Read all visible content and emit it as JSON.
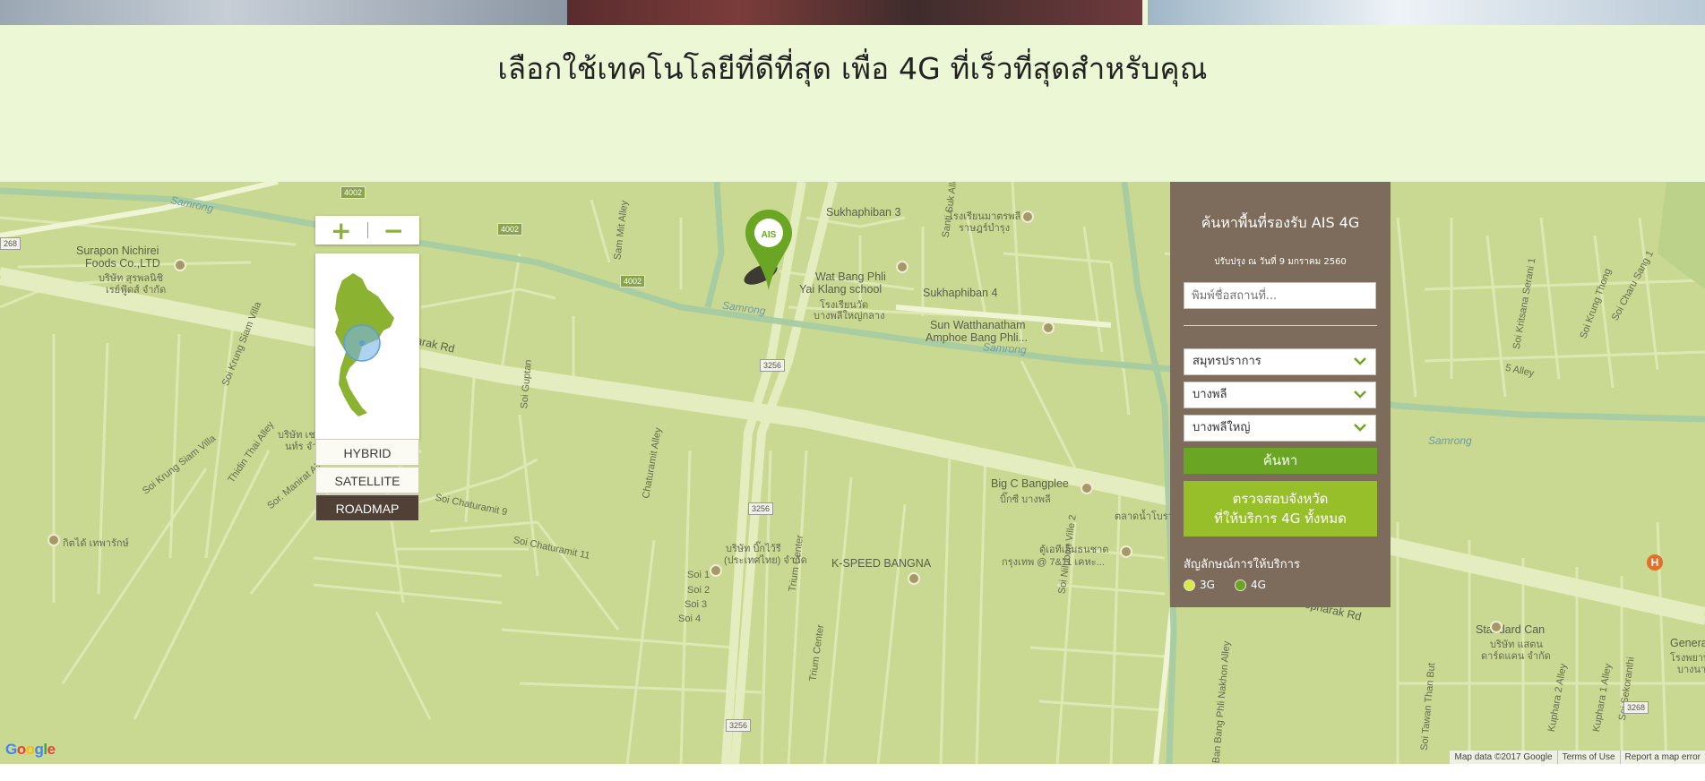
{
  "page": {
    "heading": "เลือกใช้เทคโนโลยีที่ดีที่สุด เพื่อ 4G ที่เร็วที่สุดสำหรับคุณ"
  },
  "map": {
    "zoom_in_icon": "plus-icon",
    "zoom_out_icon": "minus-icon",
    "map_types": [
      "HYBRID",
      "SATELLITE",
      "ROADMAP"
    ],
    "active_map_type": "ROADMAP",
    "marker_label": "AIS",
    "labels": {
      "surapon": "Surapon Nichirei",
      "surapon2": "Foods Co.,LTD",
      "surapon_th1": "บริษัท สุรพลนิชิ",
      "surapon_th2": "เรย์ฟู้ดส์ จำกัด",
      "sukhaphiban3": "Sukhaphiban 3",
      "sukhaphiban4": "Sukhaphiban 4",
      "watbangphli1": "Wat Bang Phli",
      "watbangphli2": "Yai Klang school",
      "watbangphli_th1": "โรงเรียนวัด",
      "watbangphli_th2": "บางพลีใหญ่กลาง",
      "sunwat1": "Sun Watthanatham",
      "sunwat2": "Amphoe Bang Phli...",
      "bigc1": "Big C Bangplee",
      "bigc_th": "บิ๊กซี บางพลี",
      "kspeed": "K-SPEED BANGNA",
      "standardcan1": "Standard Can",
      "standardcan_th1": "บริษัท แสตน",
      "standardcan_th2": "ดาร์ดแคน จำกัด",
      "thepharak": "Thepharak Rd",
      "thepharak2": "Thepharak Rd",
      "samrong1": "Samrong",
      "samrong2": "Samrong",
      "samrong3": "Samrong",
      "samrong4": "Samrong",
      "sammit": "Sam Mit Alley",
      "chaturamit9": "Soi Chaturamit 9",
      "chaturamit11": "Soi Chaturamit 11",
      "chaturamit_alley": "Chaturamit Alley",
      "soi1": "Soi 1",
      "soi2": "Soi 2",
      "soi3": "Soi 3",
      "soi4": "Soi 4",
      "trium": "Trium Center",
      "trium2": "Trium Center",
      "kingsiam": "Soi Krung Siam Villa",
      "kingsiam2": "Soi Krung Siam Villa",
      "thidin": "Thidin Thai Alley",
      "manirat": "Sor. Manirat Alley",
      "kuphara2": "Kuphara 2 Alley",
      "kuphara1": "Kuphara 1 Alley",
      "tawanthan": "Soi Tawan Than But",
      "krungthong": "Soi Krung Thong",
      "sekoranthi": "Soi Sekoranthi",
      "charu": "Soi Charu Sang 1",
      "kritsana": "Soi Kritsana Serani 1",
      "alley5": "5 Alley",
      "nilubon": "Soi Nilubon Ville 2",
      "bangphli_nakhon": "Ban Bang Phli Nakhon Alley",
      "santisuk": "Santi Suk Alley",
      "guptan": "Soi Guptan",
      "general": "Genera",
      "general_th1": "โรงพยาบา",
      "general_th2": "บางนา",
      "kittatep": "กิตได้ เทพารักษ์",
      "ams": "ตู้เอทีเอ็มธนชาต",
      "ams2": "กรุงเทพ @ 7&11 เคหะ...",
      "market": "ตลาดน้ำโบราณ",
      "bigc2": "บริษัท บิ๊กไว้รี",
      "bigc3": "(ประเทศไทย) จำกัด",
      "hospital_school": "โรงเรียนมาตรพลี",
      "hospital_school2": "ราษฎร์บำรุง",
      "nart": "นท์ร จำกัด",
      "nart2": "บริษัท เชา",
      "arak": "arak Rd",
      "shield_4002a": "4002",
      "shield_4002b": "4002",
      "shield_4002c": "4002",
      "shield_3256a": "3256",
      "shield_3256b": "3256",
      "shield_3256c": "3256",
      "shield_3268a": "3268",
      "shield_268": "268"
    },
    "attribution": [
      "Map data ©2017 Google",
      "Terms of Use",
      "Report a map error"
    ],
    "google_logo": "Google"
  },
  "panel": {
    "title": "ค้นหาพื้นที่รองรับ AIS 4G",
    "updated": "ปรับปรุง ณ วันที่ 9 มกราคม 2560",
    "search_placeholder": "พิมพ์ชื่อสถานที่...",
    "province": "สมุทรปราการ",
    "district": "บางพลี",
    "subdistrict": "บางพลีใหญ่",
    "search_button": "ค้นหา",
    "all_button_line1": "ตรวจสอบจังหวัด",
    "all_button_line2": "ที่ให้บริการ 4G ทั้งหมด",
    "legend_title": "สัญลักษณ์การให้บริการ",
    "legend": [
      {
        "label": "3G",
        "color": "#d9e94a"
      },
      {
        "label": "4G",
        "color": "#6aa524"
      }
    ]
  },
  "colors": {
    "band_bg": "#ecf7d6",
    "map_bg": "#c9d991",
    "panel_bg": "#7d6c5b",
    "accent_green": "#6aa524",
    "accent_lime": "#97bf2a",
    "active_maptype": "#514036"
  }
}
